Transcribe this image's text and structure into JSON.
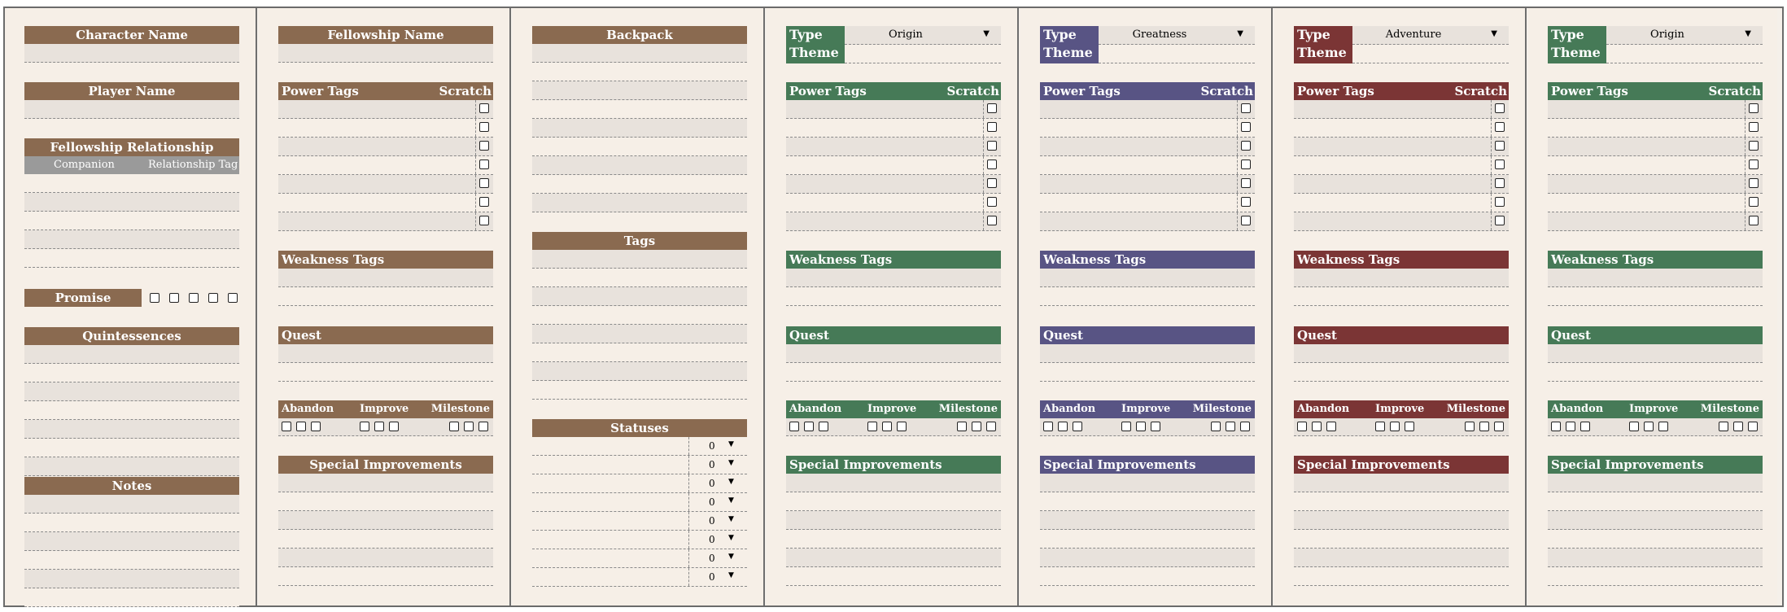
{
  "character": {
    "character_name_header": "Character Name",
    "player_name_header": "Player Name",
    "relationship_header": "Fellowship Relationship",
    "relationship_col1": "Companion",
    "relationship_col2": "Relationship Tag",
    "promise_label": "Promise",
    "quintessences_header": "Quintessences",
    "notes_header": "Notes"
  },
  "fellowship": {
    "name_header": "Fellowship Name",
    "power_tags_header": "Power Tags",
    "scratch_label": "Scratch",
    "weakness_header": "Weakness Tags",
    "quest_header": "Quest",
    "abandon": "Abandon",
    "improve": "Improve",
    "milestone": "Milestone",
    "special_header": "Special Improvements"
  },
  "backpack": {
    "backpack_header": "Backpack",
    "tags_header": "Tags",
    "statuses_header": "Statuses",
    "status_values": [
      "0",
      "0",
      "0",
      "0",
      "0",
      "0",
      "0",
      "0"
    ]
  },
  "themes": [
    {
      "type_label": "Type",
      "theme_label": "Theme",
      "value": "Origin",
      "color": "#467a57",
      "power_tags_header": "Power Tags",
      "scratch_label": "Scratch",
      "weakness_header": "Weakness Tags",
      "quest_header": "Quest",
      "abandon": "Abandon",
      "improve": "Improve",
      "milestone": "Milestone",
      "special_header": "Special Improvements"
    },
    {
      "type_label": "Type",
      "theme_label": "Theme",
      "value": "Greatness",
      "color": "#585484",
      "power_tags_header": "Power Tags",
      "scratch_label": "Scratch",
      "weakness_header": "Weakness Tags",
      "quest_header": "Quest",
      "abandon": "Abandon",
      "improve": "Improve",
      "milestone": "Milestone",
      "special_header": "Special Improvements"
    },
    {
      "type_label": "Type",
      "theme_label": "Theme",
      "value": "Adventure",
      "color": "#7b3535",
      "power_tags_header": "Power Tags",
      "scratch_label": "Scratch",
      "weakness_header": "Weakness Tags",
      "quest_header": "Quest",
      "abandon": "Abandon",
      "improve": "Improve",
      "milestone": "Milestone",
      "special_header": "Special Improvements"
    },
    {
      "type_label": "Type",
      "theme_label": "Theme",
      "value": "Origin",
      "color": "#467a57",
      "power_tags_header": "Power Tags",
      "scratch_label": "Scratch",
      "weakness_header": "Weakness Tags",
      "quest_header": "Quest",
      "abandon": "Abandon",
      "improve": "Improve",
      "milestone": "Milestone",
      "special_header": "Special Improvements"
    }
  ],
  "icons": {
    "dropdown": "chevron-down-icon",
    "checkbox": "checkbox-icon"
  },
  "colors": {
    "brown": "#8a6a50",
    "green": "#467a57",
    "purple": "#585484",
    "red": "#7b3535",
    "paper": "#f6efe7"
  }
}
